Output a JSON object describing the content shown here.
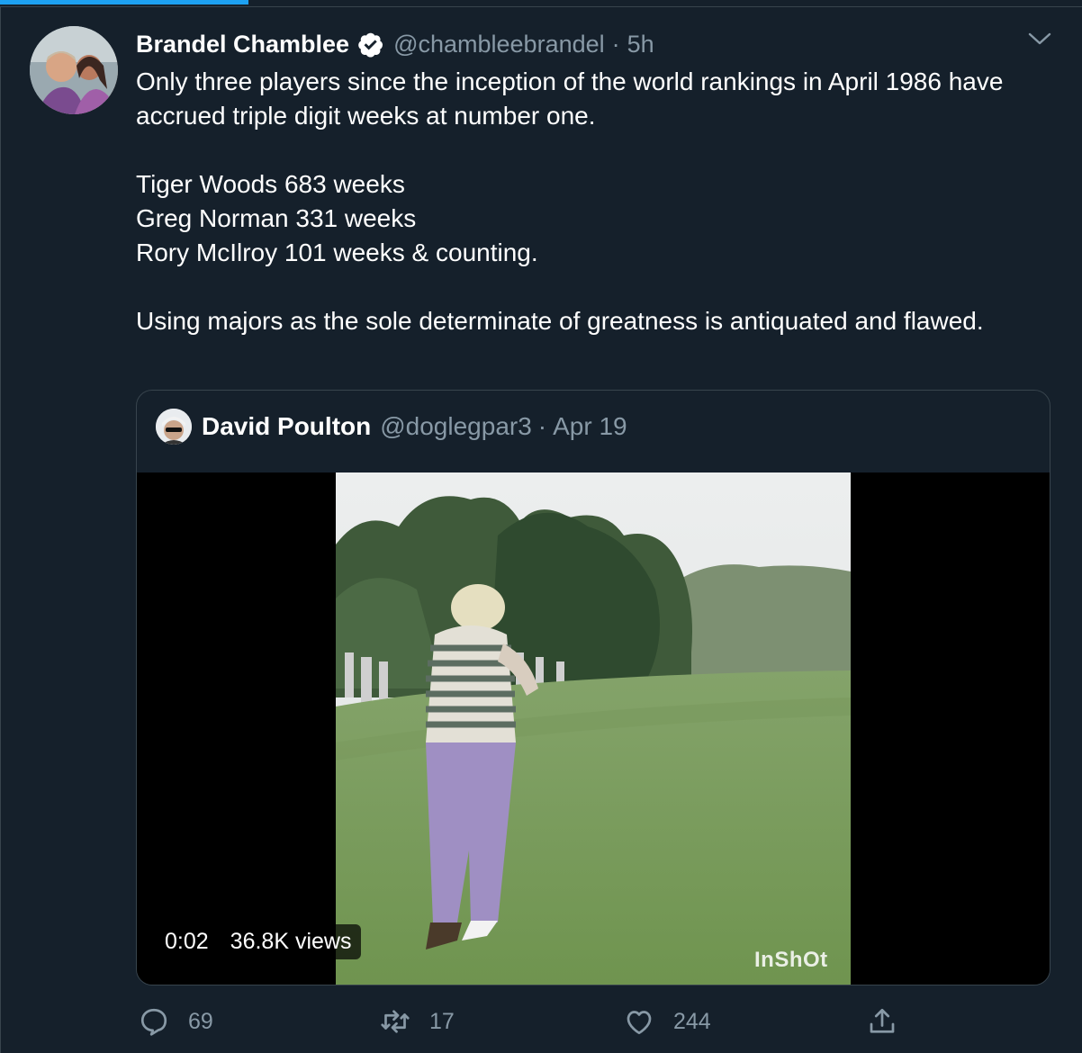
{
  "tweet": {
    "display_name": "Brandel Chamblee",
    "handle": "@chambleebrandel",
    "separator": "·",
    "time": "5h",
    "text_lines": [
      "Only three players since the inception of the world rankings in April 1986 have accrued triple digit weeks at number one.",
      "Tiger Woods 683 weeks",
      "Greg Norman 331 weeks",
      "Rory McIlroy 101 weeks & counting.",
      "Using majors as the sole determinate of greatness is antiquated and flawed."
    ]
  },
  "quote": {
    "display_name": "David Poulton",
    "handle": "@doglegpar3",
    "separator": "·",
    "date": "Apr 19",
    "video": {
      "duration": "0:02",
      "views": "36.8K views",
      "watermark": "InShOt"
    }
  },
  "actions": {
    "reply_count": "69",
    "retweet_count": "17",
    "like_count": "244"
  },
  "progress": {
    "fraction": 0.23
  },
  "colors": {
    "background": "#15202b",
    "accent": "#1da1f2",
    "secondary_text": "#8899a6",
    "border": "#38444d"
  },
  "icons": [
    "verified-badge-icon",
    "chevron-down-icon",
    "reply-icon",
    "retweet-icon",
    "like-icon",
    "share-icon"
  ]
}
